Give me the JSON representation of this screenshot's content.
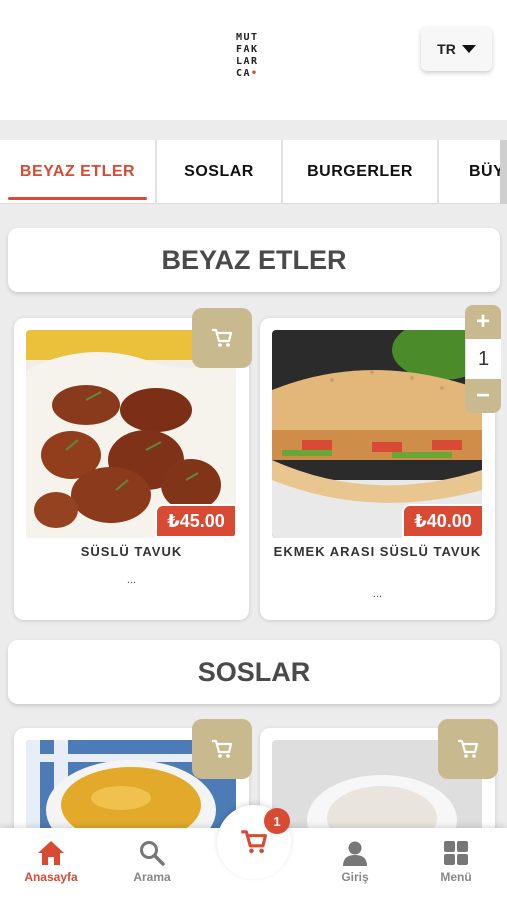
{
  "header": {
    "logo_lines": [
      "MUT",
      "FAK",
      "LAR",
      "CA"
    ],
    "language": "TR"
  },
  "tabs": [
    "BEYAZ ETLER",
    "SOSLAR",
    "BURGERLER",
    "BÜYÜ"
  ],
  "sections": [
    {
      "title": "BEYAZ ETLER",
      "products": [
        {
          "name": "SÜSLÜ TAVUK",
          "price": "₺45.00",
          "description": "..."
        },
        {
          "name": "EKMEK ARASI SÜSLÜ TAVUK",
          "price": "₺40.00",
          "description": "...",
          "quantity": "1"
        }
      ]
    },
    {
      "title": "SOSLAR"
    }
  ],
  "cart": {
    "count": "1"
  },
  "bottom_nav": {
    "home": "Anasayfa",
    "search": "Arama",
    "login": "Giriş",
    "menu": "Menü"
  },
  "colors": {
    "accent": "#d94a35",
    "gold": "#c9b98e"
  }
}
